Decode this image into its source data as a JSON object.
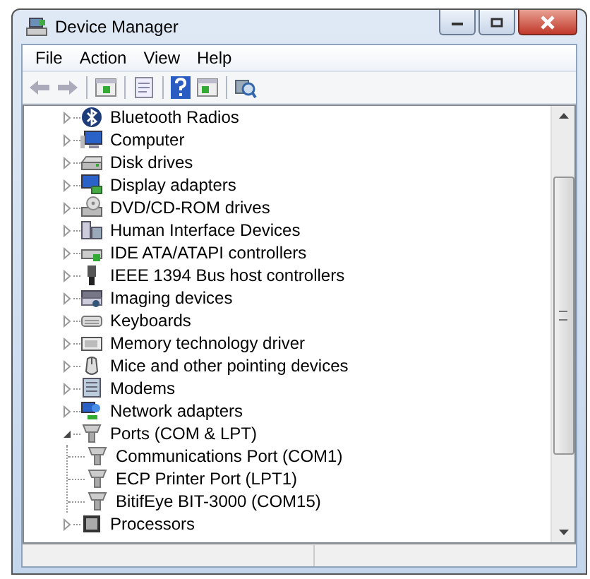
{
  "window": {
    "title": "Device Manager"
  },
  "menu": [
    "File",
    "Action",
    "View",
    "Help"
  ],
  "tree": [
    {
      "label": "Bluetooth Radios",
      "expanded": false
    },
    {
      "label": "Computer",
      "expanded": false
    },
    {
      "label": "Disk drives",
      "expanded": false
    },
    {
      "label": "Display adapters",
      "expanded": false
    },
    {
      "label": "DVD/CD-ROM drives",
      "expanded": false
    },
    {
      "label": "Human Interface Devices",
      "expanded": false
    },
    {
      "label": "IDE ATA/ATAPI controllers",
      "expanded": false
    },
    {
      "label": "IEEE 1394 Bus host controllers",
      "expanded": false
    },
    {
      "label": "Imaging devices",
      "expanded": false
    },
    {
      "label": "Keyboards",
      "expanded": false
    },
    {
      "label": "Memory technology driver",
      "expanded": false
    },
    {
      "label": "Mice and other pointing devices",
      "expanded": false
    },
    {
      "label": "Modems",
      "expanded": false
    },
    {
      "label": "Network adapters",
      "expanded": false
    },
    {
      "label": "Ports (COM & LPT)",
      "expanded": true,
      "children": [
        {
          "label": "Communications Port (COM1)"
        },
        {
          "label": "ECP Printer Port (LPT1)"
        },
        {
          "label": "BitifEye BIT-3000 (COM15)"
        }
      ]
    },
    {
      "label": "Processors",
      "expanded": false
    }
  ]
}
